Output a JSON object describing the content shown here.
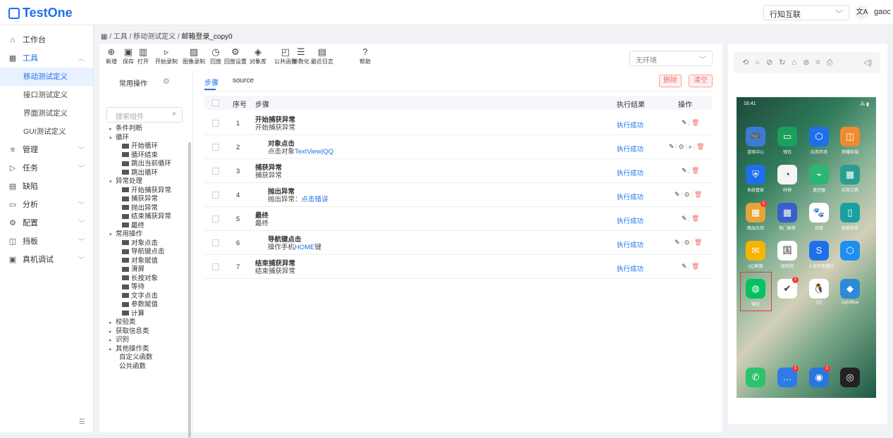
{
  "app": {
    "name": "TestOne",
    "org": "行知互联",
    "lang_icon": "文A",
    "user": "gaoc"
  },
  "sidebar": {
    "items": [
      {
        "icon": "⌂",
        "label": "工作台",
        "arrow": ""
      },
      {
        "icon": "▦",
        "label": "工具",
        "arrow": "︿"
      },
      {
        "icon": "≡",
        "label": "管理",
        "arrow": "﹀"
      },
      {
        "icon": "▷",
        "label": "任务",
        "arrow": "﹀"
      },
      {
        "icon": "▤",
        "label": "缺陷",
        "arrow": ""
      },
      {
        "icon": "▭",
        "label": "分析",
        "arrow": "﹀"
      },
      {
        "icon": "⚙",
        "label": "配置",
        "arrow": "﹀"
      },
      {
        "icon": "◫",
        "label": "挡板",
        "arrow": "﹀"
      },
      {
        "icon": "▣",
        "label": "真机调试",
        "arrow": "﹀"
      }
    ],
    "sub": [
      "移动测试定义",
      "接口测试定义",
      "界面测试定义",
      "GUI测试定义"
    ],
    "collapse_icon": "☰"
  },
  "breadcrumb": {
    "root": "▦",
    "parts": [
      "工具",
      "移动测试定义"
    ],
    "current": "邮箱登录_copy0"
  },
  "toolbar": {
    "buttons": [
      {
        "glyph": "⊕",
        "label": "新增"
      },
      {
        "glyph": "▣",
        "label": "保存"
      },
      {
        "glyph": "▥",
        "label": "打开"
      },
      {
        "glyph": "▹",
        "label": "开始录制"
      },
      {
        "glyph": "▨",
        "label": "图像录制"
      },
      {
        "glyph": "◷",
        "label": "回放"
      },
      {
        "glyph": "⚙",
        "label": "回放设置"
      },
      {
        "glyph": "◈",
        "label": "对象库"
      },
      {
        "glyph": "◰",
        "label": "公共函数"
      },
      {
        "glyph": "☰",
        "label": "参数化"
      },
      {
        "glyph": "▤",
        "label": "最近日志"
      },
      {
        "glyph": "?",
        "label": "帮助"
      }
    ],
    "env_placeholder": "无环境"
  },
  "components": {
    "title": "常用操作",
    "search_placeholder": "搜索组件",
    "tree": [
      {
        "level": 0,
        "open": false,
        "label": "条件判断"
      },
      {
        "level": 0,
        "open": true,
        "label": "循环"
      },
      {
        "level": 1,
        "label": "开始循环"
      },
      {
        "level": 1,
        "label": "循环结束"
      },
      {
        "level": 1,
        "label": "跳出当前循环"
      },
      {
        "level": 1,
        "label": "跳出循环"
      },
      {
        "level": 0,
        "open": true,
        "label": "异常处理"
      },
      {
        "level": 1,
        "label": "开始捕获异常"
      },
      {
        "level": 1,
        "label": "捕获异常"
      },
      {
        "level": 1,
        "label": "抛出异常"
      },
      {
        "level": 1,
        "label": "结束捕获异常"
      },
      {
        "level": 1,
        "label": "最终"
      },
      {
        "level": 0,
        "open": true,
        "label": "常用操作"
      },
      {
        "level": 1,
        "label": "对象点击"
      },
      {
        "level": 1,
        "label": "导航键点击"
      },
      {
        "level": 1,
        "label": "对象赋值"
      },
      {
        "level": 1,
        "label": "滑屏"
      },
      {
        "level": 1,
        "label": "长按对象"
      },
      {
        "level": 1,
        "label": "等待"
      },
      {
        "level": 1,
        "label": "文字点击"
      },
      {
        "level": 1,
        "label": "参数赋值"
      },
      {
        "level": 1,
        "label": "计算"
      },
      {
        "level": 0,
        "open": false,
        "label": "校验类"
      },
      {
        "level": 0,
        "open": false,
        "label": "获取信息类"
      },
      {
        "level": 0,
        "open": false,
        "label": "识别"
      },
      {
        "level": 0,
        "open": false,
        "label": "其他操作类"
      },
      {
        "level": 2,
        "label": "自定义函数"
      },
      {
        "level": 2,
        "label": "公共函数"
      }
    ]
  },
  "tabs": [
    "步骤",
    "source"
  ],
  "actions": {
    "delete": "删除",
    "clear": "清空"
  },
  "table": {
    "headers": [
      "序号",
      "步骤",
      "执行结果",
      "操作"
    ],
    "rows": [
      {
        "no": "1",
        "name": "开始捕获异常",
        "desc": "开始捕获异常",
        "link": "",
        "indent": 0,
        "result": "执行成功",
        "ops": "edit-del"
      },
      {
        "no": "2",
        "name": "对象点击",
        "desc": "点击对象",
        "link": "TextView|QQ",
        "indent": 1,
        "result": "执行成功",
        "ops": "full"
      },
      {
        "no": "3",
        "name": "捕获异常",
        "desc": "捕获异常",
        "link": "",
        "indent": 0,
        "result": "执行成功",
        "ops": "edit-del"
      },
      {
        "no": "4",
        "name": "抛出异常",
        "desc": "抛出异常：",
        "link": "点击错误",
        "indent": 1,
        "result": "执行成功",
        "ops": "edit-run-del"
      },
      {
        "no": "5",
        "name": "最终",
        "desc": "最终",
        "link": "",
        "indent": 0,
        "result": "执行成功",
        "ops": "edit-del"
      },
      {
        "no": "6",
        "name": "导航键点击",
        "desc": "操作手机",
        "link": "HOME",
        "suffix": "键",
        "indent": 1,
        "result": "执行成功",
        "ops": "edit-run-del"
      },
      {
        "no": "7",
        "name": "结束捕获异常",
        "desc": "结束捕获异常",
        "link": "",
        "indent": 0,
        "result": "执行成功",
        "ops": "edit-del"
      }
    ]
  },
  "device": {
    "bar_icons": "⟲ ○ ⊘ ↻ ⌂ ⊚ ⌗ ⎙",
    "vol_icon": "◁)",
    "status_left": "16:41",
    "status_right": "⁂ ▮",
    "apps": [
      {
        "label": "游戏中心",
        "color": "#3a7bd5",
        "glyph": "🎮",
        "badge": ""
      },
      {
        "label": "钱包",
        "color": "#1aa05b",
        "glyph": "▭",
        "badge": ""
      },
      {
        "label": "应用市场",
        "color": "#1f6feb",
        "glyph": "⬡",
        "badge": ""
      },
      {
        "label": "荣耀商城",
        "color": "#f08a2c",
        "glyph": "◫",
        "badge": ""
      },
      {
        "label": "系统管家",
        "color": "#1f6feb",
        "glyph": "⛨",
        "badge": ""
      },
      {
        "label": "时钟",
        "color": "#f5f5f5",
        "glyph": "◔",
        "badge": ""
      },
      {
        "label": "遥控器",
        "color": "#2bb673",
        "glyph": "⌁",
        "badge": ""
      },
      {
        "label": "实用工具",
        "color": "#2a9d8f",
        "glyph": "▦",
        "badge": ""
      },
      {
        "label": "精品应用",
        "color": "#e8a23a",
        "glyph": "▦",
        "badge": "1"
      },
      {
        "label": "热门推荐",
        "color": "#3a5fcd",
        "glyph": "▦",
        "badge": ""
      },
      {
        "label": "百度",
        "color": "#fff",
        "glyph": "🐾",
        "badge": ""
      },
      {
        "label": "智能助手",
        "color": "#1aa0a0",
        "glyph": "▯",
        "badge": ""
      },
      {
        "label": "QQ邮箱",
        "color": "#f5b400",
        "glyph": "✉",
        "badge": ""
      },
      {
        "label": "国务院",
        "color": "#fff",
        "glyph": "国",
        "badge": ""
      },
      {
        "label": "上海农商银行",
        "color": "#1f6feb",
        "glyph": "S",
        "badge": ""
      },
      {
        "label": "",
        "color": "#1f8ef1",
        "glyph": "⬡",
        "badge": ""
      },
      {
        "label": "微信",
        "color": "#07c160",
        "glyph": "◍",
        "badge": ""
      },
      {
        "label": "",
        "color": "#fff",
        "glyph": "✔",
        "badge": "1"
      },
      {
        "label": "QQ",
        "color": "#fff",
        "glyph": "🐧",
        "badge": ""
      },
      {
        "label": "LightBlue",
        "color": "#2d8bd6",
        "glyph": "◆",
        "badge": ""
      }
    ],
    "dock": [
      {
        "color": "#2bc36b",
        "glyph": "✆",
        "badge": ""
      },
      {
        "color": "#2f7be8",
        "glyph": "…",
        "badge": "1"
      },
      {
        "color": "#2a76e0",
        "glyph": "◉",
        "badge": "1"
      },
      {
        "color": "#222",
        "glyph": "◎",
        "badge": ""
      }
    ]
  }
}
